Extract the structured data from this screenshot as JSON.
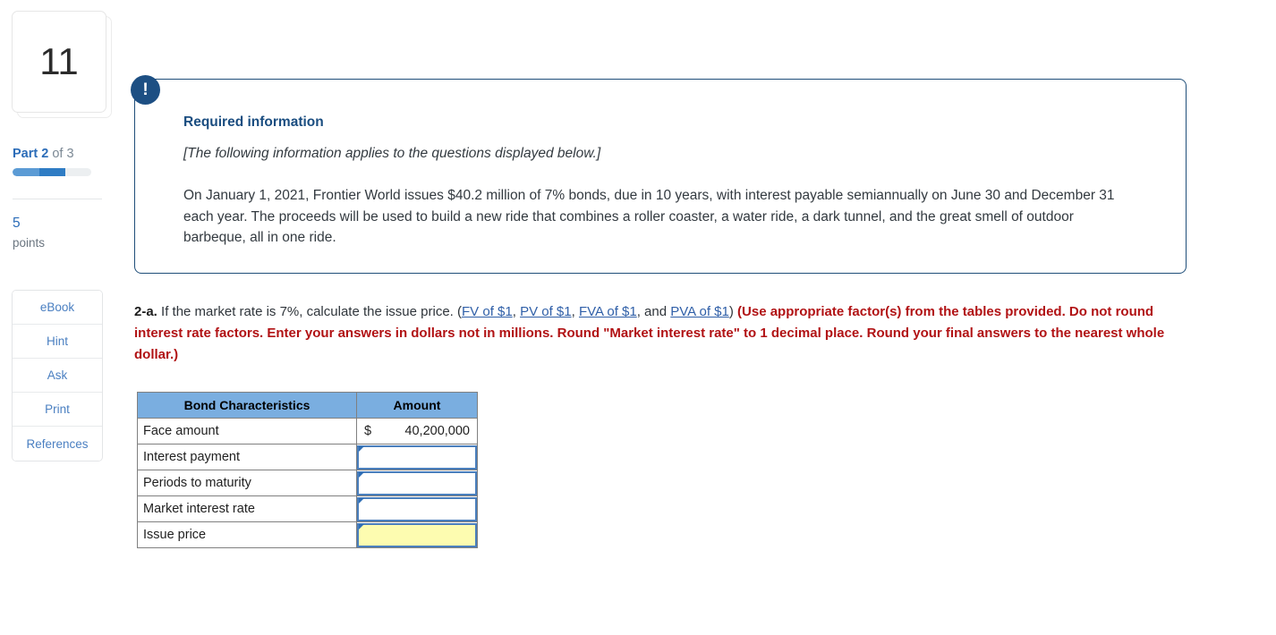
{
  "sidebar": {
    "question_number": "11",
    "part_label": "Part",
    "part_current": "2",
    "part_of": " of ",
    "part_total": "3",
    "points_value": "5",
    "points_label": "points",
    "tools": [
      {
        "label": "eBook",
        "name": "ebook"
      },
      {
        "label": "Hint",
        "name": "hint"
      },
      {
        "label": "Ask",
        "name": "ask"
      },
      {
        "label": "Print",
        "name": "print"
      },
      {
        "label": "References",
        "name": "references"
      }
    ],
    "progress": {
      "percent": 67,
      "track_color": "#eceff1",
      "segment1_color": "#5b9bd5",
      "segment2_color": "#2f7cc4"
    },
    "accent_color": "#2b6cb8"
  },
  "required_info": {
    "badge_glyph": "!",
    "badge_color": "#1d4f83",
    "title": "Required information",
    "subtitle": "[The following information applies to the questions displayed below.]",
    "body": "On January 1, 2021, Frontier World issues $40.2 million of 7% bonds, due in 10 years, with interest payable semiannually on June 30 and December 31 each year. The proceeds will be used to build a new ride that combines a roller coaster, a water ride, a dark tunnel, and the great smell of outdoor barbeque, all in one ride.",
    "border_color": "#1f4e79"
  },
  "question": {
    "number": "2-a.",
    "text_before_links": " If the market rate is 7%, calculate the issue price. (",
    "links": [
      {
        "label": "FV of $1",
        "sep": ", "
      },
      {
        "label": "PV of $1",
        "sep": ", "
      },
      {
        "label": "FVA of $1",
        "sep": ", and "
      },
      {
        "label": "PVA of $1",
        "sep": ""
      }
    ],
    "text_after_links": ") ",
    "instruction": "(Use appropriate factor(s) from the tables provided. Do not round interest rate factors. Enter your answers in dollars not in millions. Round \"Market interest rate\" to 1 decimal place. Round your final answers to the nearest whole dollar.)",
    "instruction_color": "#b11214",
    "link_color": "#2f5fa8"
  },
  "answer_table": {
    "headers": [
      "Bond Characteristics",
      "Amount"
    ],
    "header_bg": "#7aaee0",
    "highlight_bg": "#fdfcb0",
    "input_border_color": "#4a7fbd",
    "rows": [
      {
        "label": "Face amount",
        "type": "static",
        "currency": "$",
        "value": "40,200,000"
      },
      {
        "label": "Interest payment",
        "type": "input",
        "value": "",
        "highlight": false
      },
      {
        "label": "Periods to maturity",
        "type": "input",
        "value": "",
        "highlight": false
      },
      {
        "label": "Market interest rate",
        "type": "input",
        "value": "",
        "highlight": false
      },
      {
        "label": "Issue price",
        "type": "input",
        "value": "",
        "highlight": true
      }
    ]
  }
}
